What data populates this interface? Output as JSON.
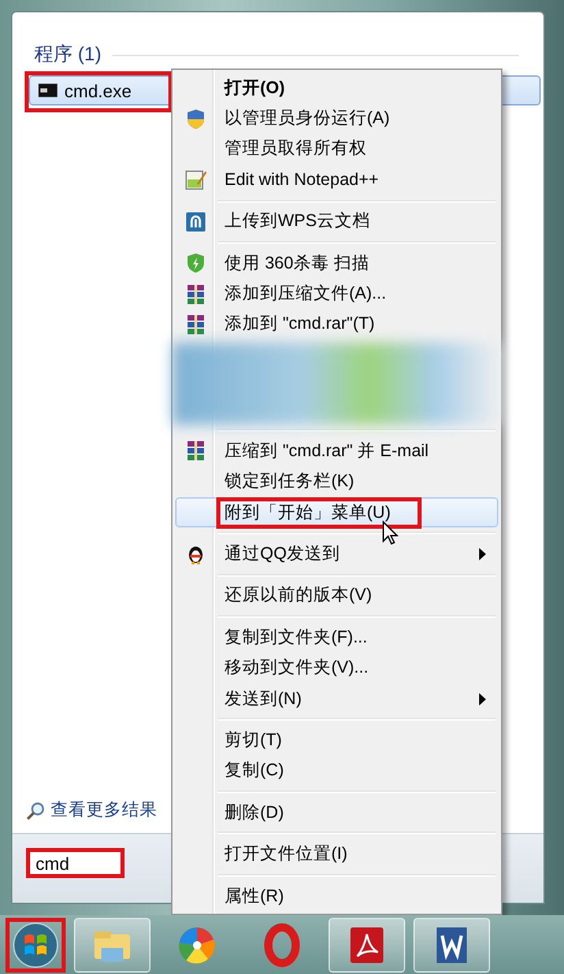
{
  "start_menu": {
    "section_title": "程序 (1)",
    "results": [
      {
        "label": "cmd.exe",
        "selected": true,
        "marked": true
      }
    ],
    "more_results_link": "查看更多结果",
    "search": {
      "value": "cmd",
      "marked": true
    }
  },
  "context_menu": {
    "items": [
      {
        "kind": "item",
        "label": "打开(O)",
        "default": true,
        "selected": false,
        "marked": false,
        "submenu": false
      },
      {
        "kind": "item",
        "label": "以管理员身份运行(A)",
        "default": false,
        "selected": false,
        "marked": false,
        "submenu": false
      },
      {
        "kind": "item",
        "label": "管理员取得所有权",
        "default": false,
        "selected": false,
        "marked": false,
        "submenu": false
      },
      {
        "kind": "item",
        "label": "Edit with Notepad++",
        "default": false,
        "selected": false,
        "marked": false,
        "submenu": false
      },
      {
        "kind": "separator"
      },
      {
        "kind": "item",
        "label": "上传到WPS云文档",
        "default": false,
        "selected": false,
        "marked": false,
        "submenu": false
      },
      {
        "kind": "separator"
      },
      {
        "kind": "item",
        "label": "使用 360杀毒 扫描",
        "default": false,
        "selected": false,
        "marked": false,
        "submenu": false
      },
      {
        "kind": "item",
        "label": "添加到压缩文件(A)...",
        "default": false,
        "selected": false,
        "marked": false,
        "submenu": false
      },
      {
        "kind": "item",
        "label": "添加到 \"cmd.rar\"(T)",
        "default": false,
        "selected": false,
        "marked": false,
        "submenu": false
      },
      {
        "kind": "blurred"
      },
      {
        "kind": "separator"
      },
      {
        "kind": "item",
        "label": "压缩到 \"cmd.rar\" 并 E-mail",
        "default": false,
        "selected": false,
        "marked": false,
        "submenu": false
      },
      {
        "kind": "item",
        "label": "锁定到任务栏(K)",
        "default": false,
        "selected": false,
        "marked": false,
        "submenu": false
      },
      {
        "kind": "item",
        "label": "附到「开始」菜单(U)",
        "default": false,
        "selected": true,
        "marked": true,
        "submenu": false
      },
      {
        "kind": "separator"
      },
      {
        "kind": "item",
        "label": "通过QQ发送到",
        "default": false,
        "selected": false,
        "marked": false,
        "submenu": true
      },
      {
        "kind": "separator"
      },
      {
        "kind": "item",
        "label": "还原以前的版本(V)",
        "default": false,
        "selected": false,
        "marked": false,
        "submenu": false
      },
      {
        "kind": "separator"
      },
      {
        "kind": "item",
        "label": "复制到文件夹(F)...",
        "default": false,
        "selected": false,
        "marked": false,
        "submenu": false
      },
      {
        "kind": "item",
        "label": "移动到文件夹(V)...",
        "default": false,
        "selected": false,
        "marked": false,
        "submenu": false
      },
      {
        "kind": "item",
        "label": "发送到(N)",
        "default": false,
        "selected": false,
        "marked": false,
        "submenu": true
      },
      {
        "kind": "separator"
      },
      {
        "kind": "item",
        "label": "剪切(T)",
        "default": false,
        "selected": false,
        "marked": false,
        "submenu": false
      },
      {
        "kind": "item",
        "label": "复制(C)",
        "default": false,
        "selected": false,
        "marked": false,
        "submenu": false
      },
      {
        "kind": "separator"
      },
      {
        "kind": "item",
        "label": "删除(D)",
        "default": false,
        "selected": false,
        "marked": false,
        "submenu": false
      },
      {
        "kind": "separator"
      },
      {
        "kind": "item",
        "label": "打开文件位置(I)",
        "default": false,
        "selected": false,
        "marked": false,
        "submenu": false
      },
      {
        "kind": "separator"
      },
      {
        "kind": "item",
        "label": "属性(R)",
        "default": false,
        "selected": false,
        "marked": false,
        "submenu": false
      }
    ]
  },
  "taskbar": {
    "start_button": {
      "marked": true
    }
  }
}
